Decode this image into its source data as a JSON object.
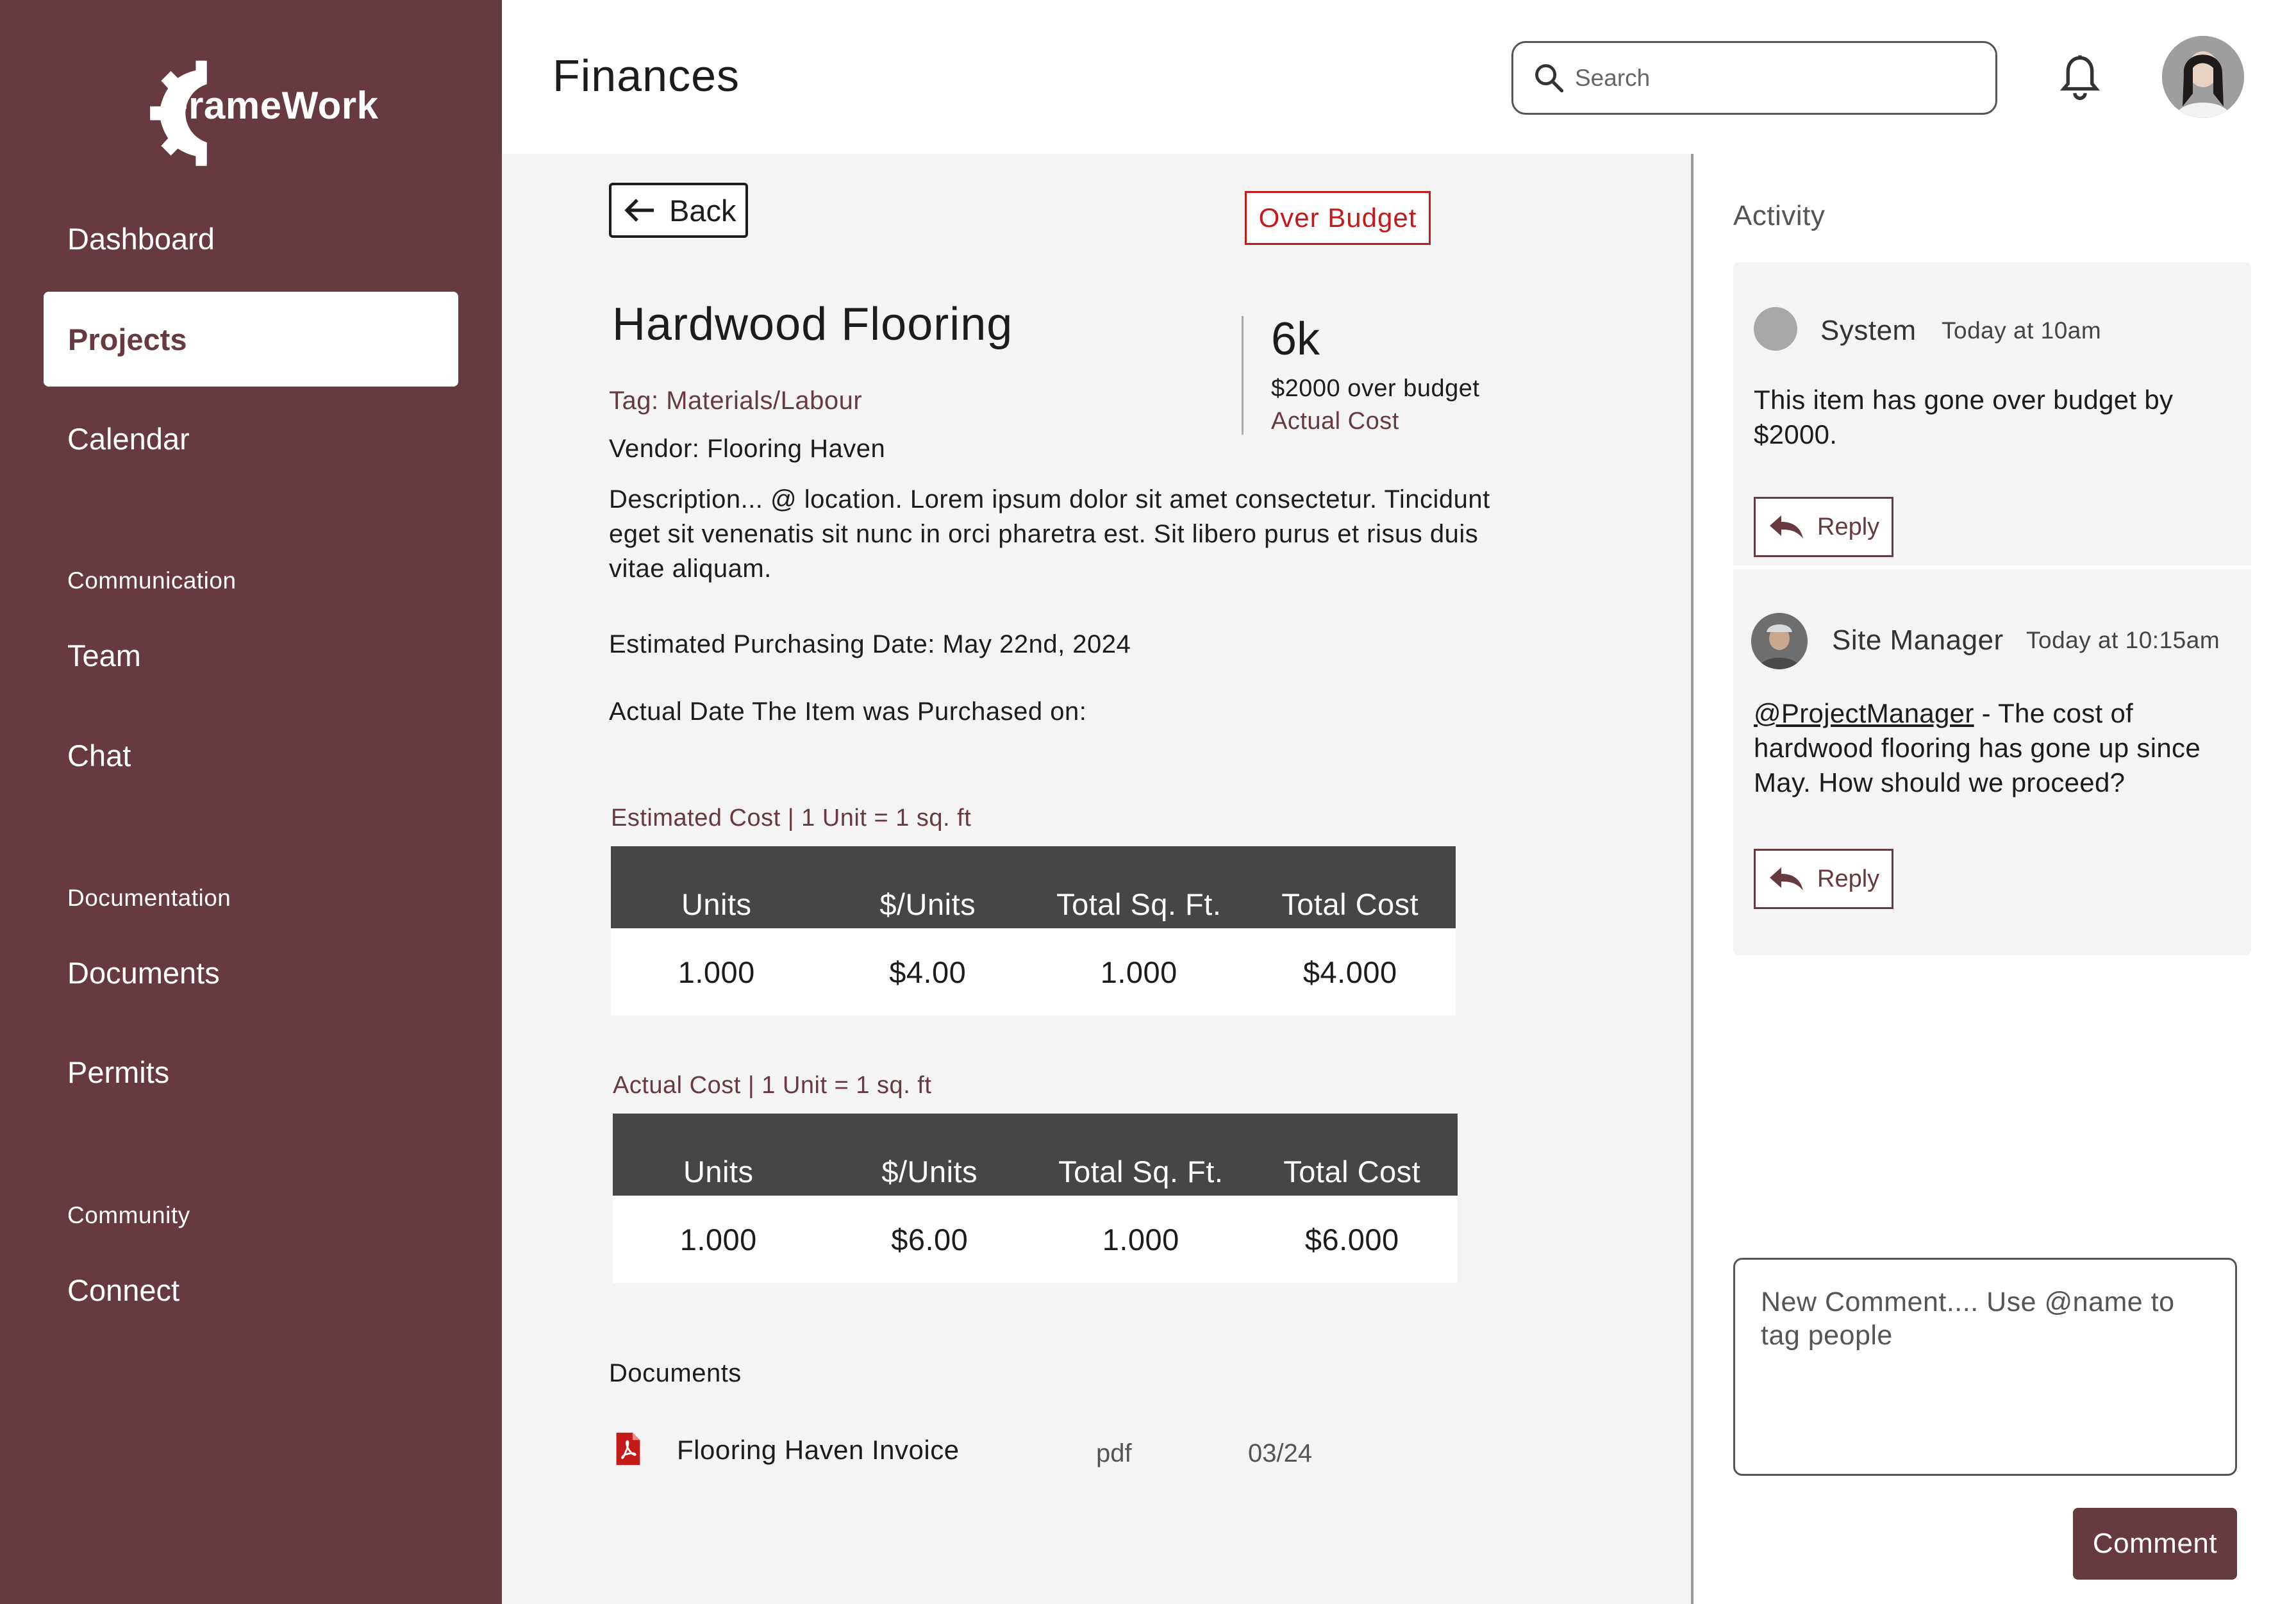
{
  "app": {
    "logo_text": "FrameWork"
  },
  "sidebar": {
    "items": [
      {
        "label": "Dashboard"
      },
      {
        "label": "Projects",
        "active": true
      },
      {
        "label": "Calendar"
      }
    ],
    "sections": [
      {
        "title": "Communication",
        "items": [
          {
            "label": "Team"
          },
          {
            "label": "Chat"
          }
        ]
      },
      {
        "title": "Documentation",
        "items": [
          {
            "label": "Documents"
          },
          {
            "label": "Permits"
          }
        ]
      },
      {
        "title": "Community",
        "items": [
          {
            "label": "Connect"
          }
        ]
      }
    ]
  },
  "header": {
    "title": "Finances",
    "search_placeholder": "Search"
  },
  "item": {
    "back_label": "Back",
    "status_badge": "Over Budget",
    "title": "Hardwood Flooring",
    "tag": "Tag: Materials/Labour",
    "vendor": "Vendor: Flooring Haven",
    "description": "Description... @ location. Lorem ipsum dolor sit amet consectetur. Tincidunt eget sit venenatis sit nunc in orci pharetra est. Sit libero purus et risus duis vitae aliquam.",
    "estimated_date": "Estimated Purchasing Date: May 22nd, 2024",
    "actual_date": "Actual Date The Item was Purchased on:",
    "summary_value": "6k",
    "summary_over": "$2000 over budget",
    "summary_label": "Actual Cost"
  },
  "tables": {
    "estimated": {
      "caption": "Estimated Cost | 1 Unit = 1 sq. ft",
      "headers": [
        "Units",
        "$/Units",
        "Total Sq. Ft.",
        "Total Cost"
      ],
      "row": [
        "1.000",
        "$4.00",
        "1.000",
        "$4.000"
      ]
    },
    "actual": {
      "caption": "Actual Cost | 1 Unit = 1 sq. ft",
      "headers": [
        "Units",
        "$/Units",
        "Total Sq. Ft.",
        "Total Cost"
      ],
      "row": [
        "1.000",
        "$6.00",
        "1.000",
        "$6.000"
      ]
    }
  },
  "documents": {
    "heading": "Documents",
    "items": [
      {
        "name": "Flooring Haven Invoice",
        "type": "pdf",
        "date": "03/24",
        "icon": "pdf-file-icon"
      }
    ]
  },
  "activity": {
    "title": "Activity",
    "comments": [
      {
        "author": "System",
        "time": "Today at 10am",
        "text": "This item has gone over budget by $2000.",
        "reply_label": "Reply"
      },
      {
        "author": "Site Manager",
        "time": "Today at 10:15am",
        "mention": "@ProjectManager",
        "text": " - The cost of hardwood flooring has gone up since May. How should we proceed?",
        "reply_label": "Reply"
      }
    ],
    "new_comment_placeholder": "New Comment.... Use @name to tag people",
    "comment_button": "Comment"
  },
  "colors": {
    "brand": "#663a40",
    "alert": "#c41a1a",
    "table_header": "#464646"
  }
}
